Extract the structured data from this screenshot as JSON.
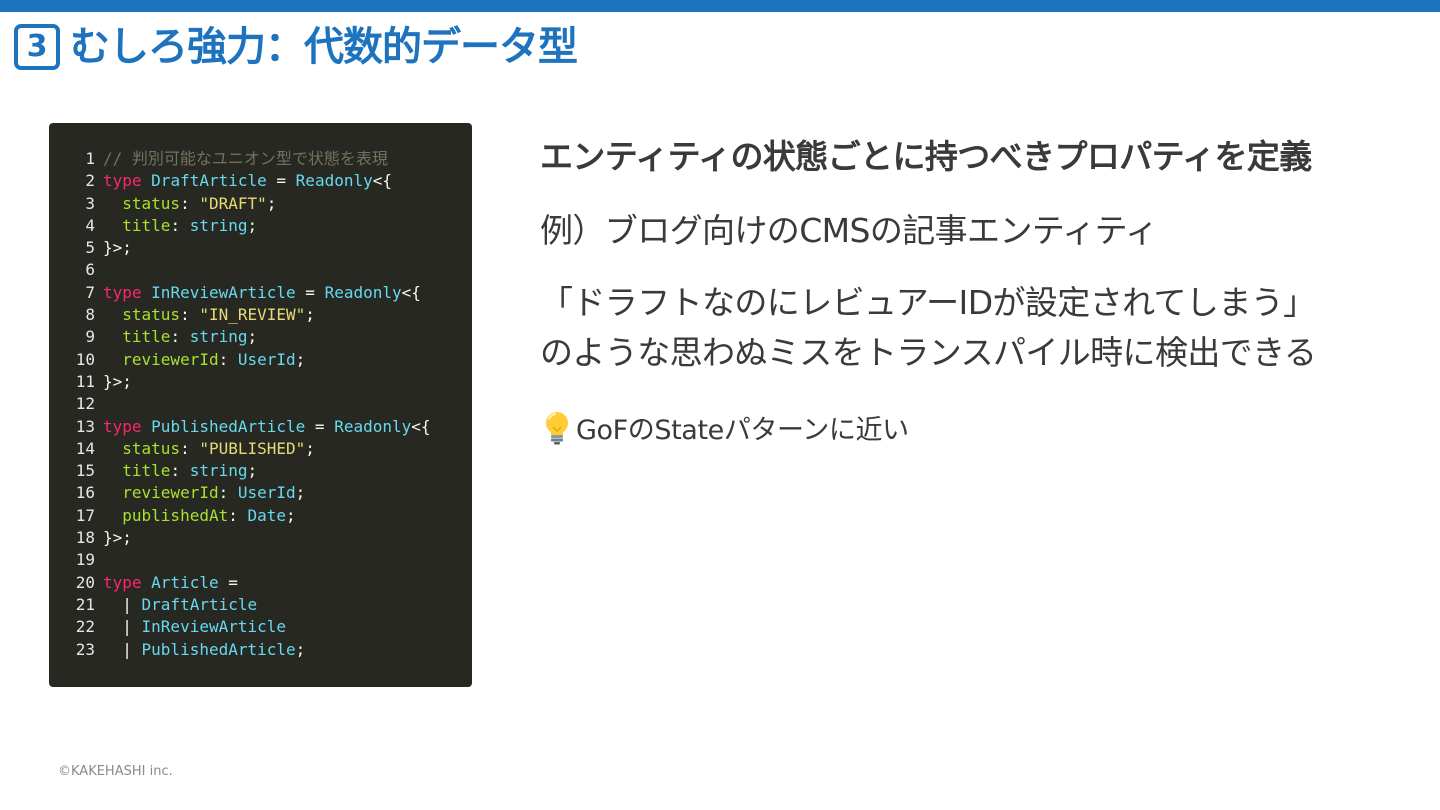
{
  "title": {
    "badge_number": "3",
    "text": "むしろ強力：代数的データ型"
  },
  "code": {
    "lines": [
      {
        "num": "1",
        "tokens": [
          {
            "t": "// 判別可能なユニオン型で状態を表現",
            "c": "comment"
          }
        ]
      },
      {
        "num": "2",
        "tokens": [
          {
            "t": "type",
            "c": "kw"
          },
          {
            "t": " ",
            "c": "punc"
          },
          {
            "t": "DraftArticle",
            "c": "type"
          },
          {
            "t": " = ",
            "c": "punc"
          },
          {
            "t": "Readonly",
            "c": "type"
          },
          {
            "t": "<{",
            "c": "punc"
          }
        ]
      },
      {
        "num": "3",
        "tokens": [
          {
            "t": "  status",
            "c": "prop"
          },
          {
            "t": ": ",
            "c": "punc"
          },
          {
            "t": "\"DRAFT\"",
            "c": "str"
          },
          {
            "t": ";",
            "c": "punc"
          }
        ]
      },
      {
        "num": "4",
        "tokens": [
          {
            "t": "  title",
            "c": "prop"
          },
          {
            "t": ": ",
            "c": "punc"
          },
          {
            "t": "string",
            "c": "type"
          },
          {
            "t": ";",
            "c": "punc"
          }
        ]
      },
      {
        "num": "5",
        "tokens": [
          {
            "t": "}>;",
            "c": "punc"
          }
        ]
      },
      {
        "num": "6",
        "tokens": []
      },
      {
        "num": "7",
        "tokens": [
          {
            "t": "type",
            "c": "kw"
          },
          {
            "t": " ",
            "c": "punc"
          },
          {
            "t": "InReviewArticle",
            "c": "type"
          },
          {
            "t": " = ",
            "c": "punc"
          },
          {
            "t": "Readonly",
            "c": "type"
          },
          {
            "t": "<{",
            "c": "punc"
          }
        ]
      },
      {
        "num": "8",
        "tokens": [
          {
            "t": "  status",
            "c": "prop"
          },
          {
            "t": ": ",
            "c": "punc"
          },
          {
            "t": "\"IN_REVIEW\"",
            "c": "str"
          },
          {
            "t": ";",
            "c": "punc"
          }
        ]
      },
      {
        "num": "9",
        "tokens": [
          {
            "t": "  title",
            "c": "prop"
          },
          {
            "t": ": ",
            "c": "punc"
          },
          {
            "t": "string",
            "c": "type"
          },
          {
            "t": ";",
            "c": "punc"
          }
        ]
      },
      {
        "num": "10",
        "tokens": [
          {
            "t": "  reviewerId",
            "c": "prop"
          },
          {
            "t": ": ",
            "c": "punc"
          },
          {
            "t": "UserId",
            "c": "type"
          },
          {
            "t": ";",
            "c": "punc"
          }
        ]
      },
      {
        "num": "11",
        "tokens": [
          {
            "t": "}>;",
            "c": "punc"
          }
        ]
      },
      {
        "num": "12",
        "tokens": []
      },
      {
        "num": "13",
        "tokens": [
          {
            "t": "type",
            "c": "kw"
          },
          {
            "t": " ",
            "c": "punc"
          },
          {
            "t": "PublishedArticle",
            "c": "type"
          },
          {
            "t": " = ",
            "c": "punc"
          },
          {
            "t": "Readonly",
            "c": "type"
          },
          {
            "t": "<{",
            "c": "punc"
          }
        ]
      },
      {
        "num": "14",
        "tokens": [
          {
            "t": "  status",
            "c": "prop"
          },
          {
            "t": ": ",
            "c": "punc"
          },
          {
            "t": "\"PUBLISHED\"",
            "c": "str"
          },
          {
            "t": ";",
            "c": "punc"
          }
        ]
      },
      {
        "num": "15",
        "tokens": [
          {
            "t": "  title",
            "c": "prop"
          },
          {
            "t": ": ",
            "c": "punc"
          },
          {
            "t": "string",
            "c": "type"
          },
          {
            "t": ";",
            "c": "punc"
          }
        ]
      },
      {
        "num": "16",
        "tokens": [
          {
            "t": "  reviewerId",
            "c": "prop"
          },
          {
            "t": ": ",
            "c": "punc"
          },
          {
            "t": "UserId",
            "c": "type"
          },
          {
            "t": ";",
            "c": "punc"
          }
        ]
      },
      {
        "num": "17",
        "tokens": [
          {
            "t": "  publishedAt",
            "c": "prop"
          },
          {
            "t": ": ",
            "c": "punc"
          },
          {
            "t": "Date",
            "c": "type"
          },
          {
            "t": ";",
            "c": "punc"
          }
        ]
      },
      {
        "num": "18",
        "tokens": [
          {
            "t": "}>;",
            "c": "punc"
          }
        ]
      },
      {
        "num": "19",
        "tokens": []
      },
      {
        "num": "20",
        "tokens": [
          {
            "t": "type",
            "c": "kw"
          },
          {
            "t": " ",
            "c": "punc"
          },
          {
            "t": "Article",
            "c": "type"
          },
          {
            "t": " =",
            "c": "punc"
          }
        ]
      },
      {
        "num": "21",
        "tokens": [
          {
            "t": "  | ",
            "c": "punc"
          },
          {
            "t": "DraftArticle",
            "c": "type"
          }
        ]
      },
      {
        "num": "22",
        "tokens": [
          {
            "t": "  | ",
            "c": "punc"
          },
          {
            "t": "InReviewArticle",
            "c": "type"
          }
        ]
      },
      {
        "num": "23",
        "tokens": [
          {
            "t": "  | ",
            "c": "punc"
          },
          {
            "t": "PublishedArticle",
            "c": "type"
          },
          {
            "t": ";",
            "c": "punc"
          }
        ]
      }
    ]
  },
  "content": {
    "heading": "エンティティの状態ごとに持つべきプロパティを定義",
    "example": "例）ブログ向けのCMSの記事エンティティ",
    "quote_line1": "「ドラフトなのにレビュアーIDが設定されてしまう」",
    "quote_line2": "のような思わぬミスをトランスパイル時に検出できる",
    "note_icon": "lightbulb-icon",
    "note_text": "GoFのStateパターンに近い"
  },
  "footer": {
    "copyright": "©KAKEHASHI inc."
  },
  "colors": {
    "accent": "#1e73be",
    "code_bg": "#272822",
    "text": "#3a3a3a"
  }
}
